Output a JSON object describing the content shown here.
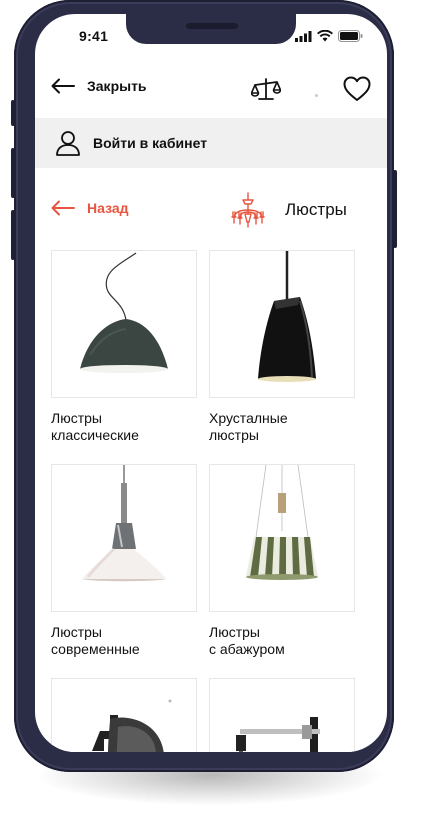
{
  "status": {
    "time": "9:41"
  },
  "topbar": {
    "close_label": "Закрыть"
  },
  "login": {
    "label": "Войти в кабинет"
  },
  "nav": {
    "back_label": "Назад",
    "category_title": "Люстры"
  },
  "categories": [
    {
      "label": "Люстры\nклассические"
    },
    {
      "label": "Хрусталные\nлюстры"
    },
    {
      "label": "Люстры\nсовременные"
    },
    {
      "label": "Люстры\nс абажуром"
    }
  ],
  "colors": {
    "accent": "#e8553f",
    "frame": "#2b2c45",
    "login_bg": "#f0f0f0"
  },
  "icons": [
    "arrow-left-icon",
    "compare-scales-icon",
    "heart-icon",
    "user-icon",
    "chandelier-icon"
  ]
}
